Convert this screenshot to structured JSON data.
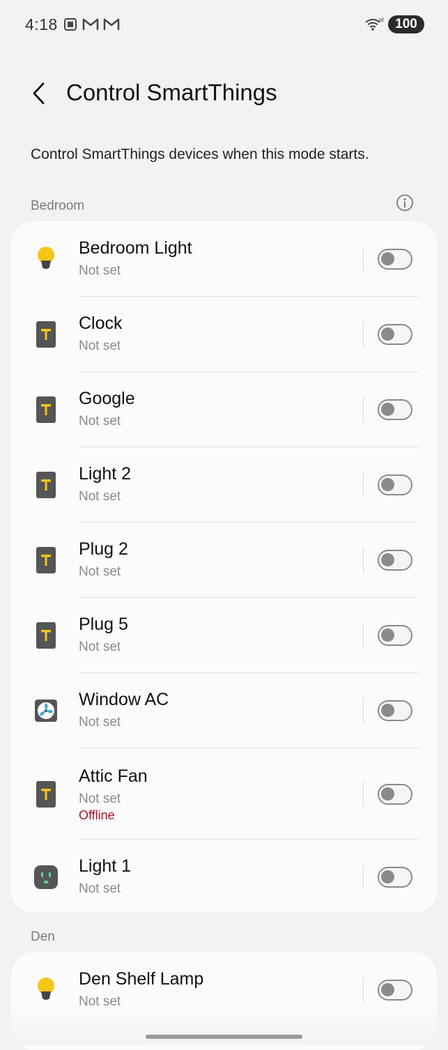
{
  "status_bar": {
    "time": "4:18",
    "battery": "100",
    "left_icons": [
      "screenshot-icon",
      "gmail-icon",
      "gmail-icon"
    ],
    "right_icons": [
      "wifi-6e-icon"
    ]
  },
  "header": {
    "title": "Control SmartThings",
    "back_icon": "chevron-left-icon"
  },
  "description": "Control SmartThings devices when this mode starts.",
  "colors": {
    "background": "#f2f2f4",
    "card": "#fbfbfc",
    "offline": "#a8142a",
    "bulb": "#f5c518",
    "device_tile": "#555555"
  },
  "sections": [
    {
      "name": "Bedroom",
      "info_icon": "info-icon",
      "devices": [
        {
          "name": "Bedroom Light",
          "status": "Not set",
          "icon": "bulb-icon",
          "on": false
        },
        {
          "name": "Clock",
          "status": "Not set",
          "icon": "light-switch-icon",
          "on": false
        },
        {
          "name": "Google",
          "status": "Not set",
          "icon": "light-switch-icon",
          "on": false
        },
        {
          "name": "Light 2",
          "status": "Not set",
          "icon": "light-switch-icon",
          "on": false
        },
        {
          "name": "Plug 2",
          "status": "Not set",
          "icon": "light-switch-icon",
          "on": false
        },
        {
          "name": "Plug 5",
          "status": "Not set",
          "icon": "light-switch-icon",
          "on": false
        },
        {
          "name": "Window AC",
          "status": "Not set",
          "icon": "fan-icon",
          "on": false
        },
        {
          "name": "Attic Fan",
          "status": "Not set",
          "offline": "Offline",
          "icon": "light-switch-icon",
          "on": false
        },
        {
          "name": "Light 1",
          "status": "Not set",
          "icon": "outlet-icon",
          "on": false
        }
      ]
    },
    {
      "name": "Den",
      "devices": [
        {
          "name": "Den Shelf Lamp",
          "status": "Not set",
          "icon": "bulb-icon",
          "on": false
        }
      ]
    }
  ]
}
